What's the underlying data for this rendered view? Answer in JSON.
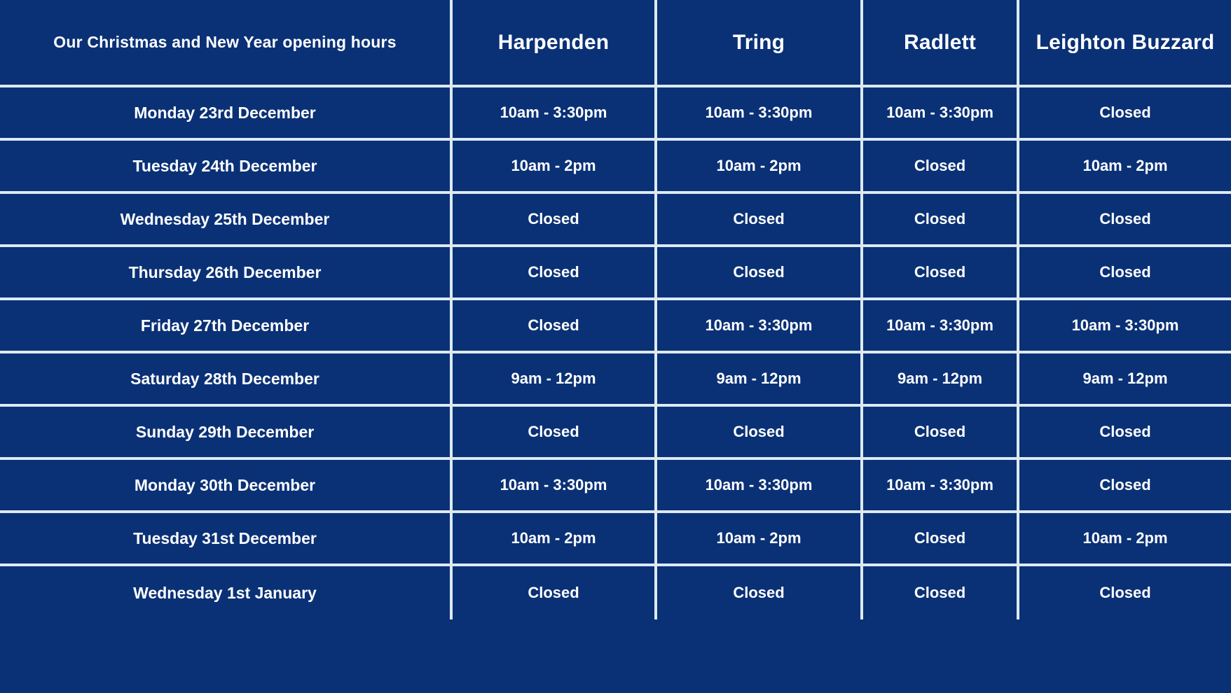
{
  "table": {
    "title_cell": "Our Christmas and New Year opening hours",
    "locations": [
      "Harpenden",
      "Tring",
      "Radlett",
      "Leighton Buzzard"
    ],
    "colors": {
      "background": "#0a3176",
      "border": "#dde9f2",
      "text": "#ffffff"
    },
    "rows": [
      {
        "day": "Monday 23rd December",
        "hours": [
          "10am - 3:30pm",
          "10am - 3:30pm",
          "10am - 3:30pm",
          "Closed"
        ]
      },
      {
        "day": "Tuesday 24th December",
        "hours": [
          "10am - 2pm",
          "10am - 2pm",
          "Closed",
          "10am - 2pm"
        ]
      },
      {
        "day": "Wednesday 25th December",
        "hours": [
          "Closed",
          "Closed",
          "Closed",
          "Closed"
        ]
      },
      {
        "day": "Thursday 26th December",
        "hours": [
          "Closed",
          "Closed",
          "Closed",
          "Closed"
        ]
      },
      {
        "day": "Friday 27th December",
        "hours": [
          "Closed",
          "10am - 3:30pm",
          "10am - 3:30pm",
          "10am - 3:30pm"
        ]
      },
      {
        "day": "Saturday 28th December",
        "hours": [
          "9am - 12pm",
          "9am - 12pm",
          "9am - 12pm",
          "9am - 12pm"
        ]
      },
      {
        "day": "Sunday 29th December",
        "hours": [
          "Closed",
          "Closed",
          "Closed",
          "Closed"
        ]
      },
      {
        "day": "Monday 30th December",
        "hours": [
          "10am - 3:30pm",
          "10am - 3:30pm",
          "10am - 3:30pm",
          "Closed"
        ]
      },
      {
        "day": "Tuesday 31st December",
        "hours": [
          "10am - 2pm",
          "10am - 2pm",
          "Closed",
          "10am - 2pm"
        ]
      },
      {
        "day": "Wednesday 1st January",
        "hours": [
          "Closed",
          "Closed",
          "Closed",
          "Closed"
        ]
      }
    ]
  }
}
